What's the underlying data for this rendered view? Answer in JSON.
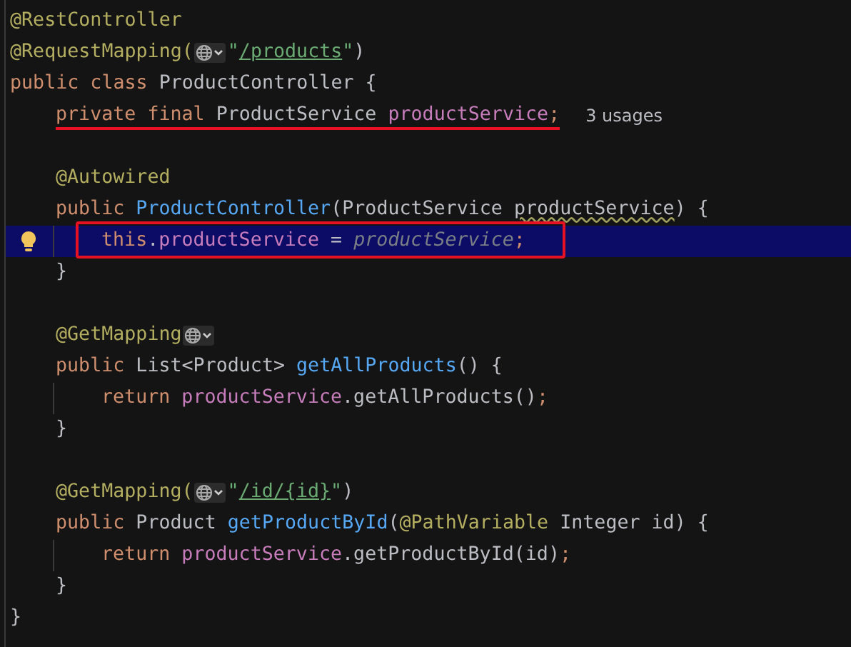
{
  "lines": [
    {
      "kind": "code",
      "tokens": [
        {
          "t": "@RestController",
          "kind": "annotation"
        }
      ]
    },
    {
      "kind": "code",
      "tokens": [
        {
          "t": "@RequestMapping(",
          "kind": "annotation"
        },
        {
          "kind": "inlay"
        },
        {
          "t": "\"",
          "kind": "string"
        },
        {
          "t": "/products",
          "kind": "url"
        },
        {
          "t": "\"",
          "kind": "string"
        },
        {
          "t": ")",
          "kind": "plain"
        }
      ]
    },
    {
      "kind": "code",
      "tokens": [
        {
          "t": "public class ",
          "kind": "keyword"
        },
        {
          "t": "ProductController {",
          "kind": "plain"
        }
      ],
      "children": [
        {
          "kind": "code",
          "underlined": true,
          "tokens": [
            {
              "t": "private final ",
              "kind": "keyword"
            },
            {
              "t": "ProductService ",
              "kind": "plain"
            },
            {
              "t": "productService",
              "kind": "field"
            },
            {
              "t": ";",
              "kind": "keyword"
            },
            {
              "t": "3 usages",
              "kind": "hint"
            }
          ]
        },
        {
          "kind": "blank"
        },
        {
          "kind": "code",
          "tokens": [
            {
              "t": "@Autowired",
              "kind": "annotation"
            }
          ]
        },
        {
          "kind": "code",
          "tokens": [
            {
              "t": "public ",
              "kind": "keyword"
            },
            {
              "t": "ProductController",
              "kind": "method"
            },
            {
              "t": "(ProductService ",
              "kind": "plain"
            },
            {
              "t": "productService",
              "kind": "warn"
            },
            {
              "t": ") {",
              "kind": "plain"
            }
          ],
          "children": [
            {
              "kind": "code",
              "current": true,
              "bulb": true,
              "boxed": true,
              "tokens": [
                {
                  "t": "this",
                  "kind": "keyword"
                },
                {
                  "t": ".",
                  "kind": "plain"
                },
                {
                  "t": "productService",
                  "kind": "field"
                },
                {
                  "t": " = ",
                  "kind": "plain"
                },
                {
                  "t": "productService",
                  "kind": "param"
                },
                {
                  "t": ";",
                  "kind": "keyword"
                }
              ]
            }
          ]
        },
        {
          "kind": "code",
          "tokens": [
            {
              "t": "}",
              "kind": "plain"
            }
          ]
        },
        {
          "kind": "blank"
        },
        {
          "kind": "code",
          "tokens": [
            {
              "t": "@GetMapping",
              "kind": "annotation"
            },
            {
              "kind": "inlay"
            }
          ]
        },
        {
          "kind": "code",
          "tokens": [
            {
              "t": "public ",
              "kind": "keyword"
            },
            {
              "t": "List<Product> ",
              "kind": "plain"
            },
            {
              "t": "getAllProducts",
              "kind": "method"
            },
            {
              "t": "() {",
              "kind": "plain"
            }
          ],
          "children": [
            {
              "kind": "code",
              "tokens": [
                {
                  "t": "return ",
                  "kind": "keyword"
                },
                {
                  "t": "productService",
                  "kind": "field"
                },
                {
                  "t": ".getAllProducts()",
                  "kind": "plain"
                },
                {
                  "t": ";",
                  "kind": "keyword"
                }
              ]
            }
          ]
        },
        {
          "kind": "code",
          "tokens": [
            {
              "t": "}",
              "kind": "plain"
            }
          ]
        },
        {
          "kind": "blank"
        },
        {
          "kind": "code",
          "tokens": [
            {
              "t": "@GetMapping(",
              "kind": "annotation"
            },
            {
              "kind": "inlay"
            },
            {
              "t": "\"",
              "kind": "string"
            },
            {
              "t": "/id/{id}",
              "kind": "url"
            },
            {
              "t": "\"",
              "kind": "string"
            },
            {
              "t": ")",
              "kind": "plain"
            }
          ]
        },
        {
          "kind": "code",
          "tokens": [
            {
              "t": "public ",
              "kind": "keyword"
            },
            {
              "t": "Product ",
              "kind": "plain"
            },
            {
              "t": "getProductById",
              "kind": "method"
            },
            {
              "t": "(",
              "kind": "plain"
            },
            {
              "t": "@PathVariable ",
              "kind": "annotation"
            },
            {
              "t": "Integer id) {",
              "kind": "plain"
            }
          ],
          "children": [
            {
              "kind": "code",
              "tokens": [
                {
                  "t": "return ",
                  "kind": "keyword"
                },
                {
                  "t": "productService",
                  "kind": "field"
                },
                {
                  "t": ".getProductById(id)",
                  "kind": "plain"
                },
                {
                  "t": ";",
                  "kind": "keyword"
                }
              ]
            }
          ]
        },
        {
          "kind": "code",
          "tokens": [
            {
              "t": "}",
              "kind": "plain"
            }
          ]
        }
      ]
    },
    {
      "kind": "code",
      "tokens": [
        {
          "t": "}",
          "kind": "plain"
        }
      ]
    }
  ]
}
